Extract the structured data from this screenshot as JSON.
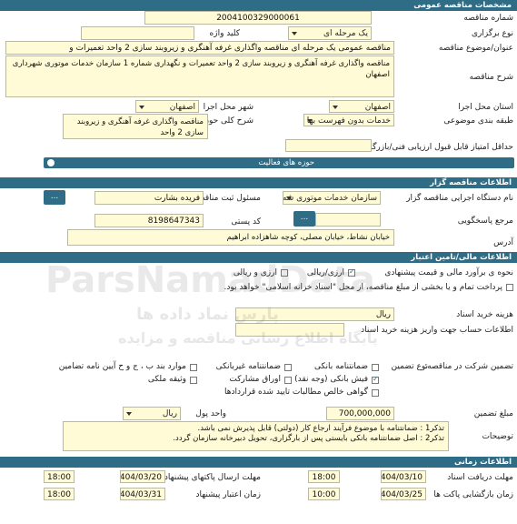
{
  "sections": {
    "top": "مشخصات مناقصه عمومی",
    "organizer": "اطلاعات مناقصه گزار",
    "financial": "اطلاعات مالی/تامین اعتبار",
    "timing": "اطلاعات زمانی"
  },
  "general": {
    "tender_number_label": "شماره مناقصه",
    "tender_number": "2004100329000061",
    "hold_type_label": "نوع برگزاری",
    "hold_type": "یک مرحله ای",
    "keyword_label": "کلید واژه",
    "keyword": "",
    "title_label": "عنوان/موضوع مناقصه",
    "title": "مناقصه عمومی یک مرحله ای مناقصه واگذاری غرفه آهنگری و زیروبند سازی 2 واحد تعمیرات و",
    "description_label": "شرح مناقصه",
    "description": "مناقصه واگذاری غرفه آهنگری و زیروبند سازی 2 واحد تعمیرات و نگهداری شماره 1 سازمان خدمات موتوری شهرداری اصفهان",
    "province_label": "استان محل اجرا",
    "province": "اصفهان",
    "city_label": "شهر محل اجرا",
    "city": "اصفهان",
    "category_label": "طبقه بندی موضوعی",
    "category": "خدمات بدون فهرست بها",
    "activity_label": "شرح کلی حوزه فعالیت",
    "activity": "مناقصه واگذاری غرفه آهنگری و زیروبند سازی 2 واحد",
    "min_score_label": "حداقل امتیاز قابل قبول ارزیابی فنی/بازرگانی",
    "min_score": "",
    "activity_bar": "حوزه های فعالیت"
  },
  "organizer": {
    "org_name_label": "نام دستگاه اجرایی مناقصه گزار",
    "org_name": "سازمان خدمات موتوری شه",
    "responsible_label": "مسئول ثبت مناقصه",
    "responsible": "فریده بشارت",
    "postal_label": "کد پستی",
    "postal_code": "8198647343",
    "authority_label": "مرجع پاسخگویی",
    "authority": "",
    "address_label": "آدرس",
    "address": "خیابان نشاط، خیابان مصلی، کوچه شاهزاده ابراهیم",
    "more_button": "..."
  },
  "financial": {
    "estimate_label": "نحوه ی برآورد مالی و قیمت پیشنهادی",
    "currency_rial": "ارزی/ریالی",
    "currency_both": "ارزی و ریالی",
    "payment_text": "پرداخت تمام و یا بخشی از مبلغ مناقصه، از محل \"اسناد خزانه اسلامی\" خواهد بود.",
    "doc_fee_label": "هزینه خرید اسناد",
    "doc_fee_unit": "ریال",
    "account_label": "اطلاعات حساب جهت واریز هزینه خرید اسناد",
    "guarantee_label": "تضمین شرکت در مناقصه:",
    "type_label": "نوع تضمین",
    "g_bank": "ضمانتنامه بانکی",
    "g_nonbank": "ضمانتنامه غیربانکی",
    "g_clause": "موارد بند ب ، ج و ح آیین نامه تضامین",
    "g_check": "فیش بانکی (وجه نقد)",
    "g_bonds": "اوراق مشارکت",
    "g_property": "وثیقه ملکی",
    "g_receivables": "گواهی خالص مطالبات تایید شده قراردادها",
    "amount_label": "مبلغ تضمین",
    "amount": "700,000,000",
    "unit_label": "واحد پول",
    "unit": "ریال",
    "notes_label": "توضیحات",
    "notes": "تذکر1 : ضمانتنامه با موضوع فرآیند ارجاع کار (دولتی) قابل پذیرش نمی باشد.\nتذکر2 : اصل ضمانتنامه بانکی بایستی پس از بارگزاری، تحویل دبیرخانه سازمان گردد."
  },
  "timing": {
    "receive_label": "مهلت دریافت اسناد",
    "receive_date": "1404/03/10",
    "receive_time": "18:00",
    "send_label": "مهلت ارسال پاکتهای پیشنهاد",
    "send_date": "1404/03/20",
    "send_time": "18:00",
    "open_label": "زمان بازگشایی پاکت ها",
    "open_date": "1404/03/25",
    "open_time": "10:00",
    "validity_label": "زمان اعتبار پیشنهاد",
    "validity_date": "1404/03/31",
    "validity_time": "18:00"
  },
  "watermark": {
    "brand_en": "ParsNamadData",
    "brand_fa": "پارس نماد داده ها",
    "slogan_fa": "پایگاه اطلاع رسانی مناقصه و مزایده"
  },
  "colors": {
    "header": "#2f6d86",
    "field": "#fffbd6"
  }
}
